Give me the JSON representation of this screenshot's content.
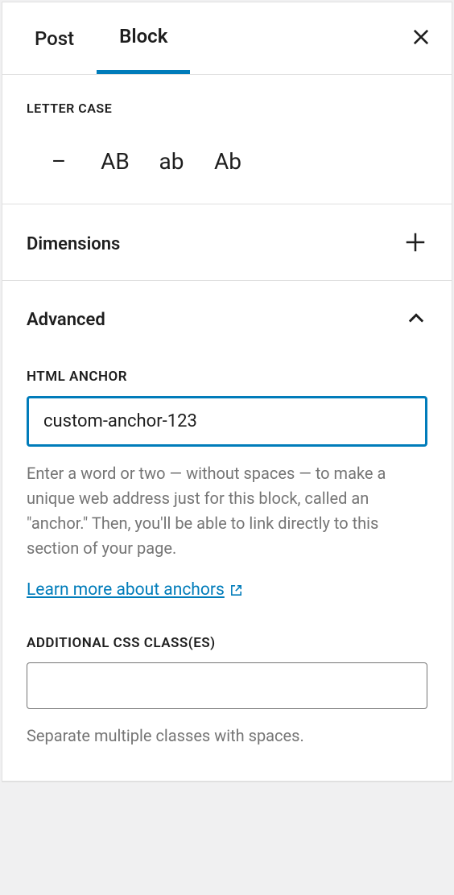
{
  "tabs": {
    "post": "Post",
    "block": "Block"
  },
  "letterCase": {
    "label": "LETTER CASE",
    "options": {
      "none": "–",
      "upper": "AB",
      "lower": "ab",
      "capitalize": "Ab"
    }
  },
  "dimensions": {
    "title": "Dimensions"
  },
  "advanced": {
    "title": "Advanced",
    "htmlAnchor": {
      "label": "HTML ANCHOR",
      "value": "custom-anchor-123",
      "help": "Enter a word or two — without spaces — to make a unique web address just for this block, called an \"anchor.\" Then, you'll be able to link directly to this section of your page.",
      "learnMore": "Learn more about anchors"
    },
    "cssClasses": {
      "label": "ADDITIONAL CSS CLASS(ES)",
      "value": "",
      "help": "Separate multiple classes with spaces."
    }
  }
}
